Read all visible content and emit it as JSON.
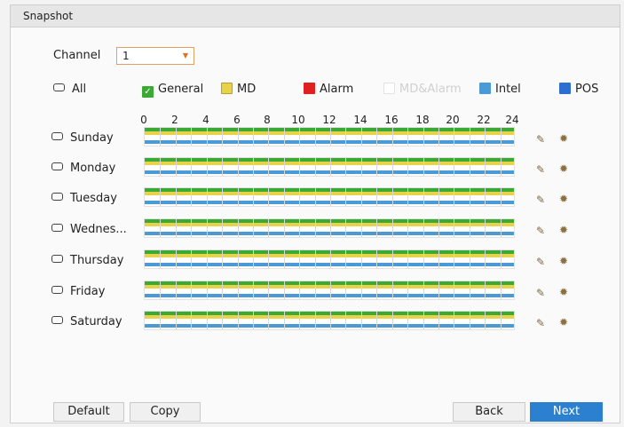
{
  "window": {
    "title": "Snapshot"
  },
  "channel": {
    "label": "Channel",
    "value": "1"
  },
  "legend": {
    "all_label": "All",
    "items": [
      {
        "name": "general",
        "label": "General",
        "color": "#3aaa35",
        "checked": true
      },
      {
        "name": "md",
        "label": "MD",
        "color": "#e8d24a",
        "checked": false
      },
      {
        "name": "alarm",
        "label": "Alarm",
        "color": "#e02020",
        "checked": false
      },
      {
        "name": "md-alarm",
        "label": "MD&Alarm",
        "color": "#e8e8e8",
        "checked": false,
        "disabled": true
      },
      {
        "name": "intel",
        "label": "Intel",
        "color": "#4a9ad8",
        "checked": false
      },
      {
        "name": "pos",
        "label": "POS",
        "color": "#2c6fd0",
        "checked": false
      }
    ]
  },
  "hours": [
    "0",
    "2",
    "4",
    "6",
    "8",
    "10",
    "12",
    "14",
    "16",
    "18",
    "20",
    "22",
    "24"
  ],
  "days": [
    {
      "label": "Sunday"
    },
    {
      "label": "Monday"
    },
    {
      "label": "Tuesday"
    },
    {
      "label": "Wednes..."
    },
    {
      "label": "Thursday"
    },
    {
      "label": "Friday"
    },
    {
      "label": "Saturday"
    }
  ],
  "buttons": {
    "default": "Default",
    "copy": "Copy",
    "back": "Back",
    "next": "Next"
  }
}
